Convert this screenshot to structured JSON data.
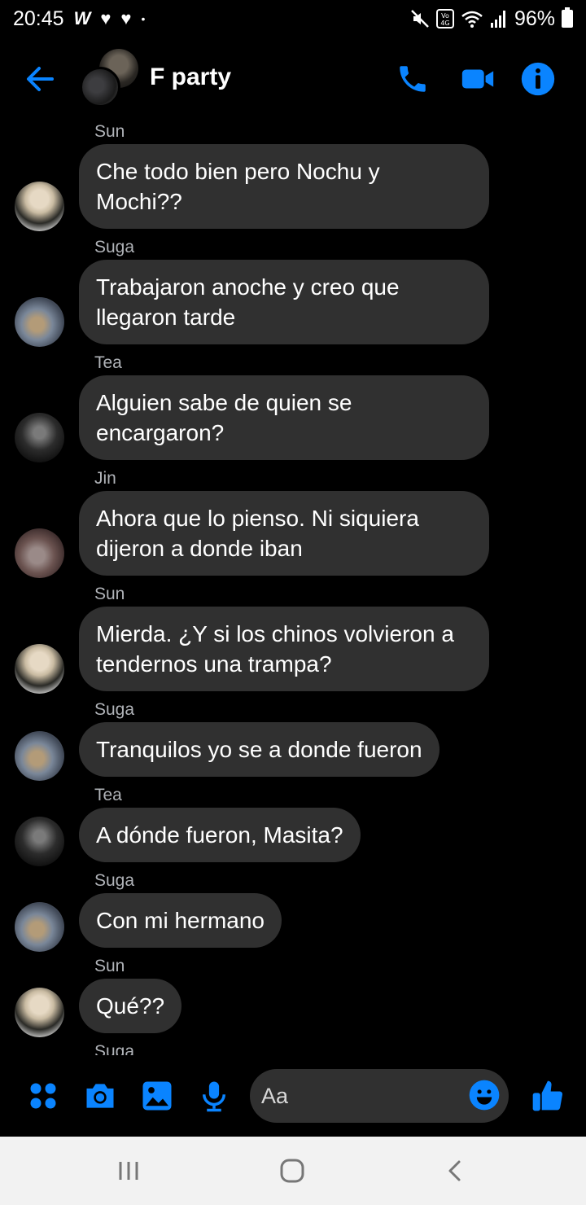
{
  "status_bar": {
    "time": "20:45",
    "battery": "96%"
  },
  "header": {
    "title": "F party"
  },
  "messages": [
    {
      "sender": "Sun",
      "text": "Che todo bien pero Nochu y Mochi??",
      "avatar": "sun"
    },
    {
      "sender": "Suga",
      "text": "Trabajaron anoche y creo que llegaron tarde",
      "avatar": "suga"
    },
    {
      "sender": "Tea",
      "text": "Alguien sabe de quien se encargaron?",
      "avatar": "tea"
    },
    {
      "sender": "Jin",
      "text": "Ahora que lo pienso. Ni siquiera dijeron a donde iban",
      "avatar": "jin"
    },
    {
      "sender": "Sun",
      "text": "Mierda. ¿Y si los chinos volvieron a tendernos una trampa?",
      "avatar": "sun"
    },
    {
      "sender": "Suga",
      "text": "Tranquilos yo se a donde fueron",
      "avatar": "suga"
    },
    {
      "sender": "Tea",
      "text": "A dónde fueron, Masita?",
      "avatar": "tea"
    },
    {
      "sender": "Suga",
      "text": "Con mi hermano",
      "avatar": "suga"
    },
    {
      "sender": "Sun",
      "text": "Qué??",
      "avatar": "sun"
    },
    {
      "sender": "Suga",
      "text": "",
      "avatar": "suga"
    }
  ],
  "composer": {
    "placeholder": "Aa"
  },
  "colors": {
    "accent": "#0a84ff",
    "bubble": "#303030",
    "background": "#000000",
    "sender_label": "#b0b3b8",
    "navbar": "#f2f2f2"
  },
  "icons": {
    "header": [
      "back-arrow-icon",
      "phone-icon",
      "video-camera-icon",
      "info-icon"
    ],
    "composer": [
      "apps-icon",
      "camera-icon",
      "gallery-icon",
      "microphone-icon",
      "emoji-icon",
      "like-icon"
    ],
    "navbar": [
      "recents-icon",
      "home-icon",
      "back-icon"
    ]
  }
}
